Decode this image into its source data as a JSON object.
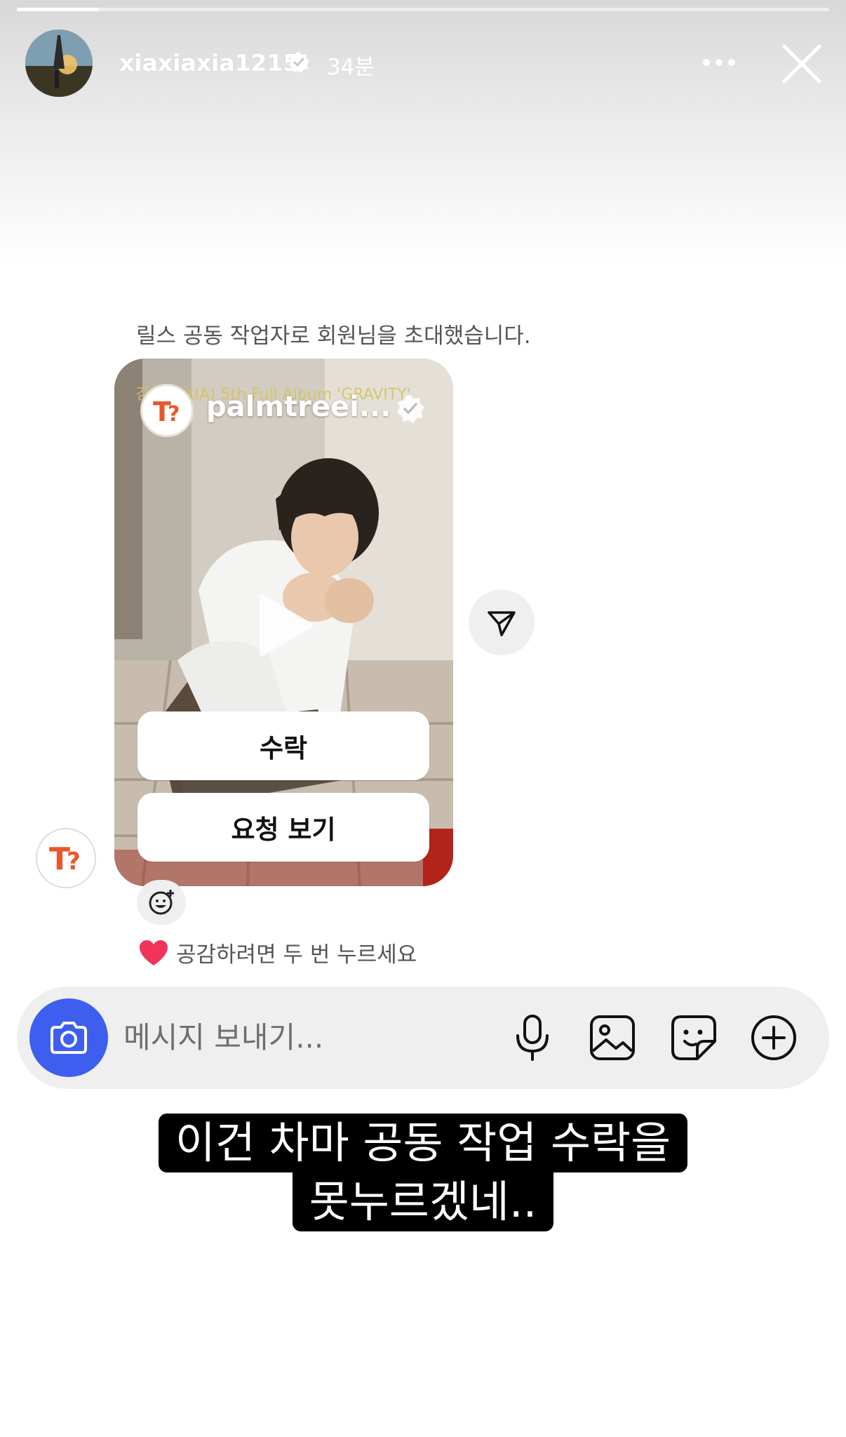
{
  "story": {
    "progress": 0.1,
    "username": "xiaxiaxia1215",
    "time": "34분"
  },
  "message": {
    "invite_text": "릴스 공동 작업자로 회원님을 초대했습니다.",
    "reel": {
      "account": "palmtreei...",
      "overlay_text": "김준수(XIA) 5th Full Album 'GRAVITY'",
      "accept_label": "수락",
      "view_request_label": "요청 보기"
    },
    "like_hint": "공감하려면 두 번 누르세요"
  },
  "composer": {
    "placeholder": "메시지 보내기..."
  },
  "caption": {
    "line1": "이건 차마 공동 작업 수락을",
    "line2": "못누르겠네.."
  },
  "colors": {
    "camera_button": "#3e5ef0",
    "heart": "#f0345a",
    "logo_orange": "#e8572a"
  }
}
